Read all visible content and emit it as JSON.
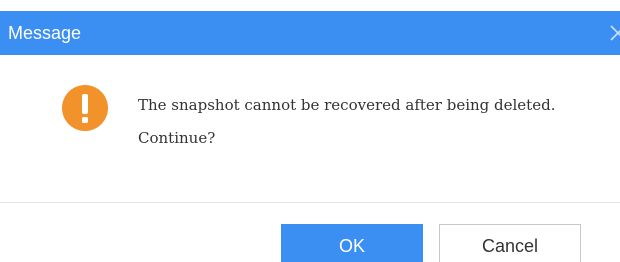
{
  "dialog": {
    "title": "Message",
    "close_icon": "close-icon",
    "warning_icon": "exclamation-icon",
    "message_line1": "The snapshot cannot be recovered after being deleted.",
    "message_line2": "Continue?",
    "ok_label": "OK",
    "cancel_label": "Cancel"
  },
  "colors": {
    "title_bar": "#3b8ff2",
    "warning": "#f2922a",
    "primary_button": "#3b8ff2"
  }
}
